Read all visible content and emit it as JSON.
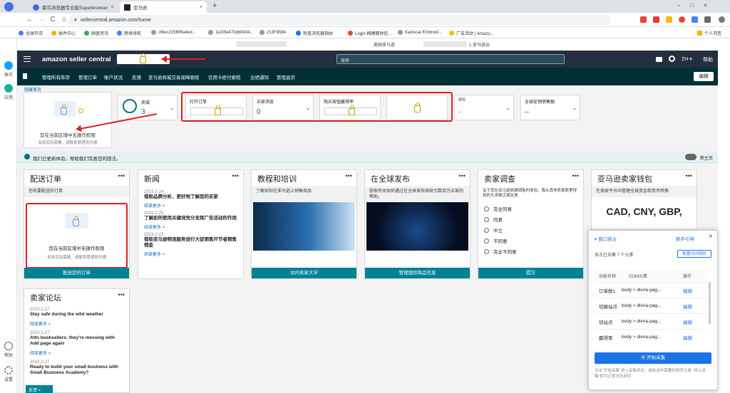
{
  "browser": {
    "tabs": [
      {
        "label": "紫鸟浏览器专业版Superbrowser",
        "close": "×"
      },
      {
        "label": "亚马逊",
        "close": "×"
      }
    ],
    "new_tab": "+",
    "url": "sellercentral.amazon.com/home",
    "nav": {
      "back": "←",
      "forward": "→",
      "reload": "C",
      "home": "⌂"
    },
    "bookmarks": [
      "全球开店",
      "插件中心",
      "国营资讯",
      "跨境导航",
      "cf6ec215f6f9a4ed...",
      "1e20fe470db0434...",
      "213F8584",
      "检查浏览器指纹",
      "Login 棉建都供信...",
      "Kaloscai Embroid...",
      "广告活动 | Amazo..."
    ],
    "bookmark_folder": "个人书签",
    "header_center": "美国亚马逊",
    "header_right": "1.亚马逊云"
  },
  "left_sidebar": [
    {
      "label": "账号"
    },
    {
      "label": "应用"
    },
    {
      "label": "帮助"
    },
    {
      "label": "设置"
    }
  ],
  "amazon": {
    "logo": "amazon seller central",
    "search_placeholder": "搜索",
    "lang": "ZH ▾",
    "help": "帮助",
    "nav": [
      "管理所有库存",
      "管理订单",
      "账户状况",
      "反馈",
      "亚马逊商城交易保障索赔",
      "信用卡拒付索赔",
      "业绩通知",
      "管理退货"
    ],
    "edit": "编辑",
    "hidden_label": "隐藏首页",
    "no_permission": "您在当前区域中无操作权限",
    "no_permission_sub": "如有实际需要，请联系管理员开通",
    "marketplace_label": "商城",
    "marketplace_value": "3",
    "open_orders": "打开订单",
    "buyer_messages": "买家消息",
    "buybox": "购买按钮赢得率",
    "ips": "IPS",
    "ips_value": "-",
    "global_sales": "全球促销销售额",
    "global_sales_value": "--",
    "buyer_msg_value": "0",
    "banner": "我们已更新体验。帮助我们完善您的想法。",
    "toggle_label": "新主页"
  },
  "widgets": {
    "orders": {
      "title": "配送订单",
      "sub": "您有要配送的订单",
      "button": "配送您的订单"
    },
    "news": {
      "title": "新闻",
      "items": [
        {
          "date": "2023-2-24",
          "title": "借助品牌分析，更好地了解您的买家",
          "link": "阅读更多 >"
        },
        {
          "date": "2023-2-25",
          "title": "了解如何使用关键词竞分发挥广告活动的作用",
          "link": "阅读更多 >"
        },
        {
          "date": "2023-2-23",
          "title": "借助亚马逊物流服务进行大促销售开节者销售佣金",
          "link": "阅读更多 >"
        }
      ]
    },
    "training": {
      "title": "教程和培训",
      "sub": "了解如何在亚马逊上销售商品",
      "button": "访问卖家大学"
    },
    "global": {
      "title": "在全球发布",
      "sub": "获取有关如何通过在全球发布来吸引数百万买家的帮助。",
      "button": "管理国际商品信息"
    },
    "survey": {
      "title": "卖家调查",
      "sub": "关于您在亚马逊商城销售的体验，我从其他卖家那里得到的大多数正面反馈",
      "options": [
        "完全同意",
        "同意",
        "中立",
        "不同意",
        "完全不同意"
      ],
      "button": "提交"
    },
    "wallet": {
      "title": "亚马逊卖家钱包",
      "sub": "在卖家平台中管理全球资金和货币转换",
      "currencies": "CAD, CNY, GBP,"
    },
    "forum": {
      "title": "卖家论坛",
      "items": [
        {
          "date": "2023-2-27",
          "title": "Stay safe during the wild weather",
          "link": "阅读更多 >"
        },
        {
          "date": "2023-2-27",
          "title": "Attn booksellers: they're messing with Add page again",
          "link": "阅读更多 >"
        },
        {
          "date": "2023-2-27",
          "title": "Ready to build your small business with Small Business Academy?",
          "link": ""
        }
      ],
      "feedback": "反馈"
    }
  },
  "collector": {
    "title": "窗口商主",
    "guide": "新手引导",
    "close": "×",
    "info": "本次已采集 7 个元素",
    "config_btn": "配置访问规则",
    "cols": [
      "功能名称",
      "DOM元素",
      "操作"
    ],
    "rows": [
      {
        "name": "订单数1",
        "dom": "body > div#a-pag...",
        "op": "编辑"
      },
      {
        "name": "切换站点",
        "dom": "body > div#a-pag...",
        "op": "编辑"
      },
      {
        "name": "切站点",
        "dom": "body > div#a-pag...",
        "op": "编辑"
      },
      {
        "name": "赢得率",
        "dom": "body > div#a-pag...",
        "op": "编辑"
      }
    ],
    "start_btn": "开始采集",
    "footer": "点击\"开始采集\"进入采集状态，鼠标选中需要的网页元素 \"停止采集\"即可正常浏览网页"
  },
  "colors": {
    "amazon_dark": "#232f3e",
    "subnav": "#002f36",
    "teal": "#008296",
    "red_annotation": "#e02020",
    "panel_blue": "#1a73e8"
  }
}
